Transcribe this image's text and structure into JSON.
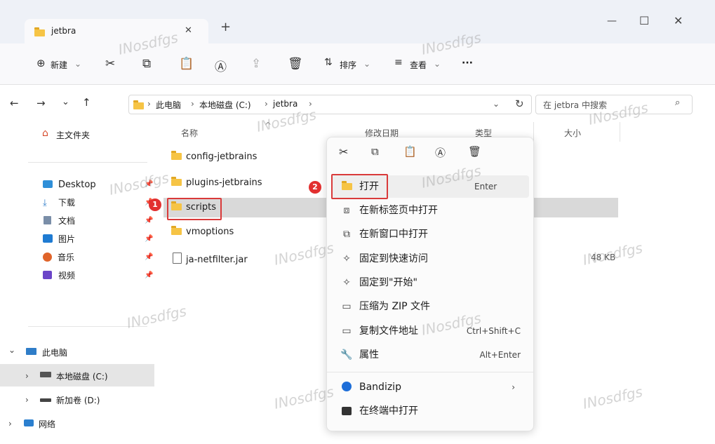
{
  "window": {
    "tab_title": "jetbra",
    "minimize": "—",
    "maximize": "☐",
    "close": "✕",
    "tab_close": "✕",
    "new_tab": "+"
  },
  "toolbar": {
    "new": "新建",
    "sort": "排序",
    "view": "查看",
    "more": "···"
  },
  "address": {
    "crumbs": [
      "此电脑",
      "本地磁盘 (C:)",
      "jetbra"
    ],
    "sep": "›",
    "search_placeholder": "在 jetbra 中搜索"
  },
  "nav": {
    "quick": "主文件夹",
    "pinned": [
      {
        "label": "Desktop"
      },
      {
        "label": "下载"
      },
      {
        "label": "文档"
      },
      {
        "label": "图片"
      },
      {
        "label": "音乐"
      },
      {
        "label": "视频"
      }
    ],
    "tree": [
      {
        "label": "此电脑",
        "chev": "⌄"
      },
      {
        "label": "本地磁盘 (C:)",
        "chev": "›"
      },
      {
        "label": "新加卷 (D:)",
        "chev": "›"
      },
      {
        "label": "网络",
        "chev": "›"
      }
    ]
  },
  "columns": {
    "name": "名称",
    "date": "修改日期",
    "type": "类型",
    "size": "大小"
  },
  "files": [
    {
      "name": "config-jetbrains",
      "kind": "folder",
      "size": ""
    },
    {
      "name": "plugins-jetbrains",
      "kind": "folder",
      "size": ""
    },
    {
      "name": "scripts",
      "kind": "folder",
      "size": ""
    },
    {
      "name": "vmoptions",
      "kind": "folder",
      "size": ""
    },
    {
      "name": "ja-netfilter.jar",
      "kind": "file",
      "size": "48 KB"
    }
  ],
  "context_menu": {
    "items": [
      {
        "label": "打开",
        "shortcut": "Enter"
      },
      {
        "label": "在新标签页中打开",
        "shortcut": ""
      },
      {
        "label": "在新窗口中打开",
        "shortcut": ""
      },
      {
        "label": "固定到快速访问",
        "shortcut": ""
      },
      {
        "label": "固定到\"开始\"",
        "shortcut": ""
      },
      {
        "label": "压缩为 ZIP 文件",
        "shortcut": ""
      },
      {
        "label": "复制文件地址",
        "shortcut": "Ctrl+Shift+C"
      },
      {
        "label": "属性",
        "shortcut": "Alt+Enter"
      },
      {
        "label": "Bandizip",
        "shortcut": "›"
      },
      {
        "label": "在终端中打开",
        "shortcut": ""
      }
    ]
  },
  "badges": {
    "one": "1",
    "two": "2"
  },
  "watermark": "INosdfgs"
}
